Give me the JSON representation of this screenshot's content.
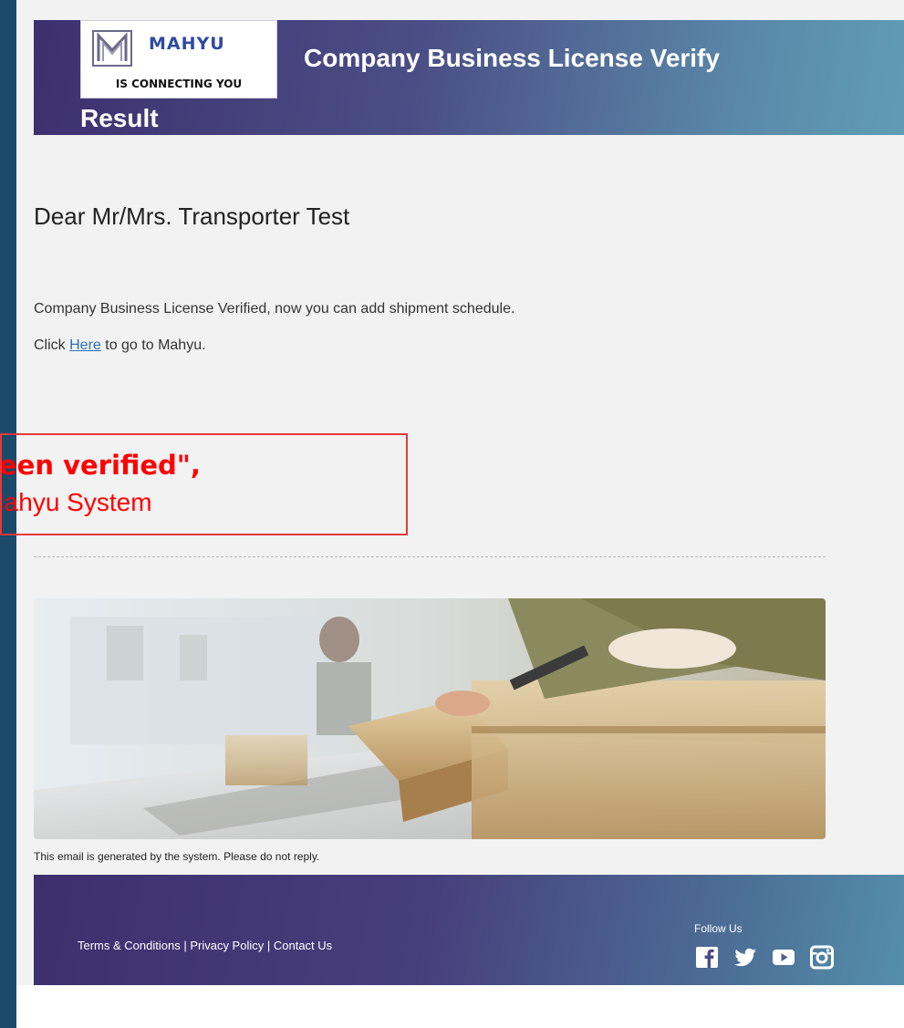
{
  "brand": {
    "name": "MAHYU",
    "tagline": "IS CONNECTING YOU"
  },
  "header": {
    "title_line1": "Company Business License Verify",
    "title_line2": "Result"
  },
  "body": {
    "greeting": "Dear Mr/Mrs. Transporter Test",
    "message": "Company Business License Verified, now you can add shipment schedule.",
    "cta_prefix": "Click ",
    "cta_link": "Here",
    "cta_suffix": " to go to Mahyu."
  },
  "callout": {
    "line1": "ave been verified\",",
    "line2": "ess Mahyu System"
  },
  "disclaimer": "This email is generated by the system. Please do not reply.",
  "footer": {
    "links": [
      "Terms & Conditions",
      "Privacy Policy",
      "Contact Us"
    ],
    "separator": " | ",
    "follow_label": "Follow Us",
    "social": [
      "facebook-icon",
      "twitter-icon",
      "youtube-icon",
      "instagram-icon"
    ]
  },
  "colors": {
    "header_start": "#3d2f6e",
    "header_end": "#5f9db4",
    "callout": "#ff0000",
    "link": "#2a6fb8"
  }
}
